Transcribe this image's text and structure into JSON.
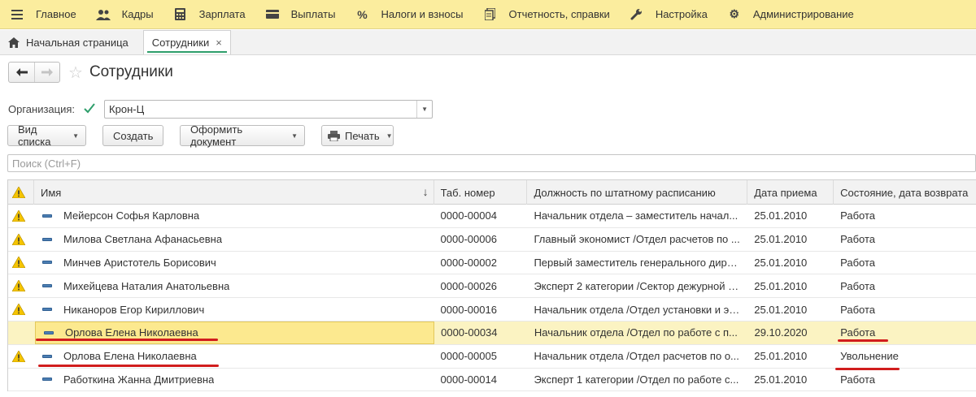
{
  "menu": [
    {
      "label": "Главное",
      "icon": "hamburger-icon"
    },
    {
      "label": "Кадры",
      "icon": "people-icon"
    },
    {
      "label": "Зарплата",
      "icon": "calculator-icon"
    },
    {
      "label": "Выплаты",
      "icon": "wallet-icon"
    },
    {
      "label": "Налоги и взносы",
      "icon": "percent-icon"
    },
    {
      "label": "Отчетность, справки",
      "icon": "report-icon"
    },
    {
      "label": "Настройка",
      "icon": "wrench-icon"
    },
    {
      "label": "Администрирование",
      "icon": "gear-icon"
    }
  ],
  "tabs": {
    "home": "Начальная страница",
    "active": "Сотрудники"
  },
  "page": {
    "title": "Сотрудники"
  },
  "org": {
    "label": "Организация:",
    "value": "Крон-Ц",
    "checked": true
  },
  "toolbar": {
    "view_list": "Вид списка",
    "create": "Создать",
    "make_document": "Оформить документ",
    "print": "Печать"
  },
  "search": {
    "placeholder": "Поиск (Ctrl+F)"
  },
  "table": {
    "columns": [
      "Имя",
      "Таб. номер",
      "Должность по штатному расписанию",
      "Дата приема",
      "Состояние, дата возврата"
    ],
    "rows": [
      {
        "warn": true,
        "name": "Мейерсон Софья Карловна",
        "tab": "0000-00004",
        "position": "Начальник отдела – заместитель начал...",
        "date": "25.01.2010",
        "state": "Работа"
      },
      {
        "warn": true,
        "name": "Милова Светлана Афанасьевна",
        "tab": "0000-00006",
        "position": "Главный экономист /Отдел расчетов по ...",
        "date": "25.01.2010",
        "state": "Работа"
      },
      {
        "warn": true,
        "name": "Минчев Аристотель Борисович",
        "tab": "0000-00002",
        "position": "Первый заместитель генерального дире...",
        "date": "25.01.2010",
        "state": "Работа"
      },
      {
        "warn": true,
        "name": "Михейцева Наталия Анатольевна",
        "tab": "0000-00026",
        "position": "Эксперт 2 категории /Сектор дежурной с...",
        "date": "25.01.2010",
        "state": "Работа"
      },
      {
        "warn": true,
        "name": "Никаноров Егор Кириллович",
        "tab": "0000-00016",
        "position": "Начальник отдела /Отдел установки и эк...",
        "date": "25.01.2010",
        "state": "Работа"
      },
      {
        "warn": false,
        "name": "Орлова Елена Николаевна",
        "tab": "0000-00034",
        "position": "Начальник отдела /Отдел по работе с п...",
        "date": "29.10.2020",
        "state": "Работа"
      },
      {
        "warn": true,
        "name": "Орлова Елена Николаевна",
        "tab": "0000-00005",
        "position": "Начальник отдела /Отдел расчетов по о...",
        "date": "25.01.2010",
        "state": "Увольнение"
      },
      {
        "warn": false,
        "name": "Работкина Жанна Дмитриевна",
        "tab": "0000-00014",
        "position": "Эксперт 1 категории /Отдел по работе с...",
        "date": "25.01.2010",
        "state": "Работа"
      }
    ]
  },
  "colors": {
    "menu_bg": "#fbed9e",
    "selected_row": "#fbf3c2",
    "annotation_red": "#d11d1d",
    "check_green": "#2e9e6b",
    "warning_yellow": "#f5c400"
  }
}
